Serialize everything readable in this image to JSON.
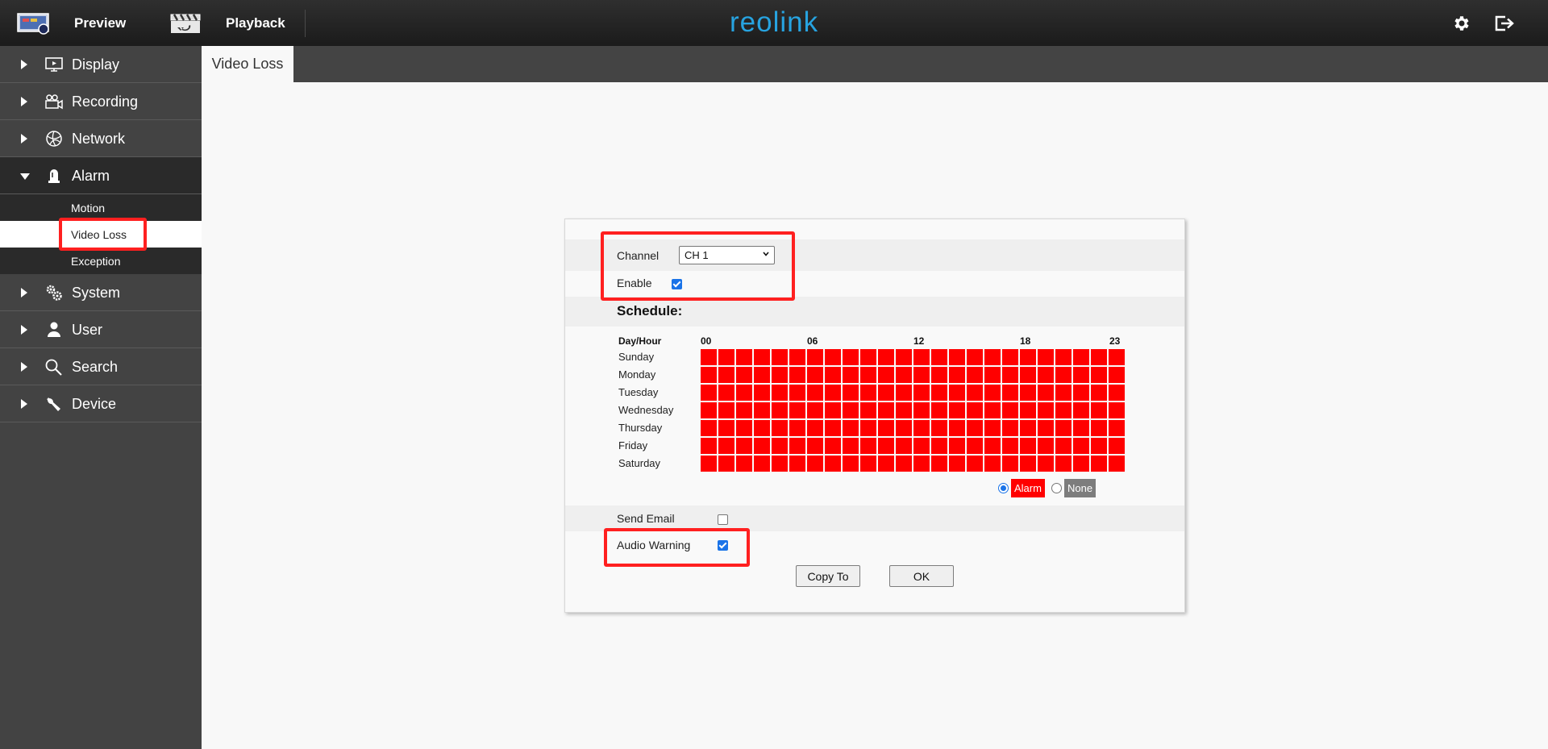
{
  "topbar": {
    "preview_label": "Preview",
    "playback_label": "Playback",
    "logo_text": "reolink",
    "brand_color": "#27a3e0"
  },
  "sidebar": {
    "items": [
      {
        "label": "Display",
        "icon": "monitor-icon"
      },
      {
        "label": "Recording",
        "icon": "camera-icon"
      },
      {
        "label": "Network",
        "icon": "network-icon"
      },
      {
        "label": "Alarm",
        "icon": "alarm-icon",
        "expanded": true
      },
      {
        "label": "System",
        "icon": "gears-icon"
      },
      {
        "label": "User",
        "icon": "user-icon"
      },
      {
        "label": "Search",
        "icon": "search-icon"
      },
      {
        "label": "Device",
        "icon": "wrench-icon"
      }
    ],
    "alarm_subitems": [
      {
        "label": "Motion"
      },
      {
        "label": "Video Loss",
        "active": true
      },
      {
        "label": "Exception"
      }
    ]
  },
  "tab": {
    "label": "Video Loss"
  },
  "form": {
    "channel_label": "Channel",
    "channel_value": "CH 1",
    "enable_label": "Enable",
    "enable_checked": true,
    "schedule_title": "Schedule:",
    "send_email_label": "Send Email",
    "send_email_checked": false,
    "audio_warning_label": "Audio Warning",
    "audio_warning_checked": true,
    "copy_to_label": "Copy To",
    "ok_label": "OK"
  },
  "schedule": {
    "header_label": "Day/Hour",
    "hour_labels": [
      "00",
      "06",
      "12",
      "18",
      "23"
    ],
    "days": [
      "Sunday",
      "Monday",
      "Tuesday",
      "Wednesday",
      "Thursday",
      "Friday",
      "Saturday"
    ],
    "hours_per_day": 24,
    "all_cells": "alarm",
    "alarm_color": "#ff0000",
    "legend_alarm_label": "Alarm",
    "legend_none_label": "None",
    "legend_selected": "alarm"
  }
}
